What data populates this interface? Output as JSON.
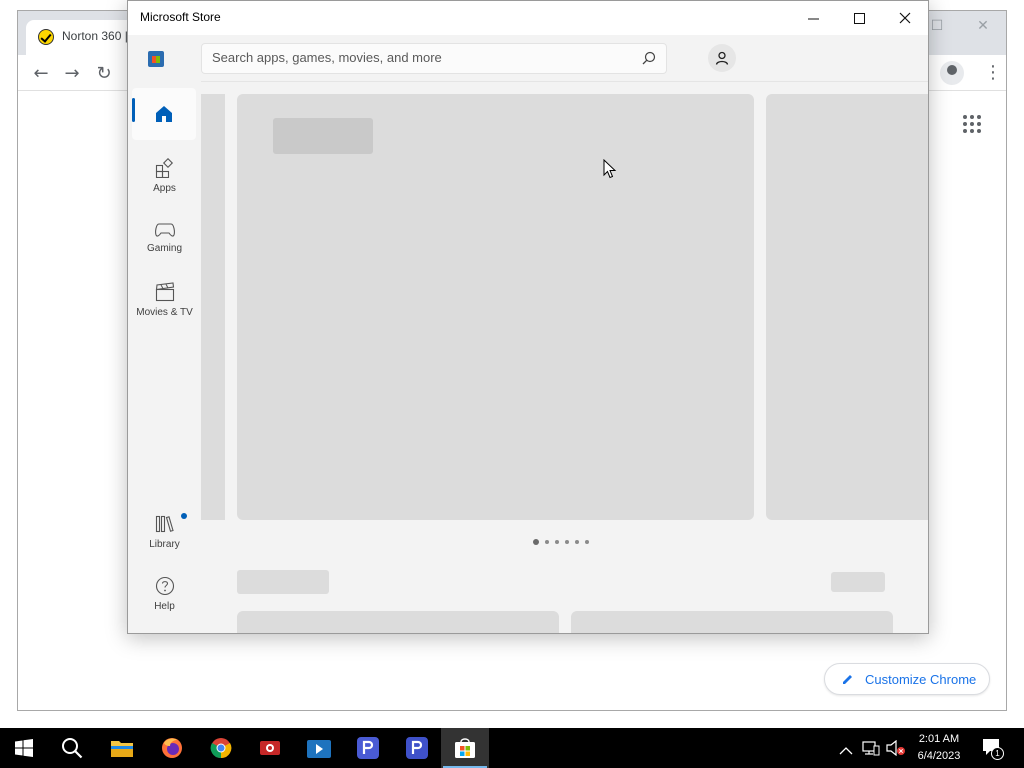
{
  "chrome": {
    "tab_title": "Norton 360 |",
    "customize_label": "Customize Chrome",
    "minimize_glyph": "—",
    "maximize_glyph": "☐",
    "close_glyph": "✕"
  },
  "store": {
    "window_title": "Microsoft Store",
    "search_placeholder": "Search apps, games, movies, and more",
    "nav": [
      {
        "label": "",
        "icon": "home-icon",
        "active": true
      },
      {
        "label": "Apps",
        "icon": "apps-icon"
      },
      {
        "label": "Gaming",
        "icon": "gamepad-icon"
      },
      {
        "label": "Movies & TV",
        "icon": "clapperboard-icon"
      },
      {
        "label": "Library",
        "icon": "library-icon",
        "has_badge": true
      },
      {
        "label": "Help",
        "icon": "help-icon"
      }
    ],
    "carousel_pages": 6,
    "carousel_active_index": 0,
    "accent_color": "#005fb8"
  },
  "taskbar": {
    "time": "2:01 AM",
    "date": "6/4/2023",
    "notification_count": "1",
    "pinned": [
      "windows-start-icon",
      "search-icon",
      "file-explorer-icon",
      "firefox-icon",
      "chrome-icon",
      "video-app-icon",
      "store-like-app-icon",
      "p-app-icon",
      "p-app-icon-2",
      "microsoft-store-icon"
    ]
  }
}
